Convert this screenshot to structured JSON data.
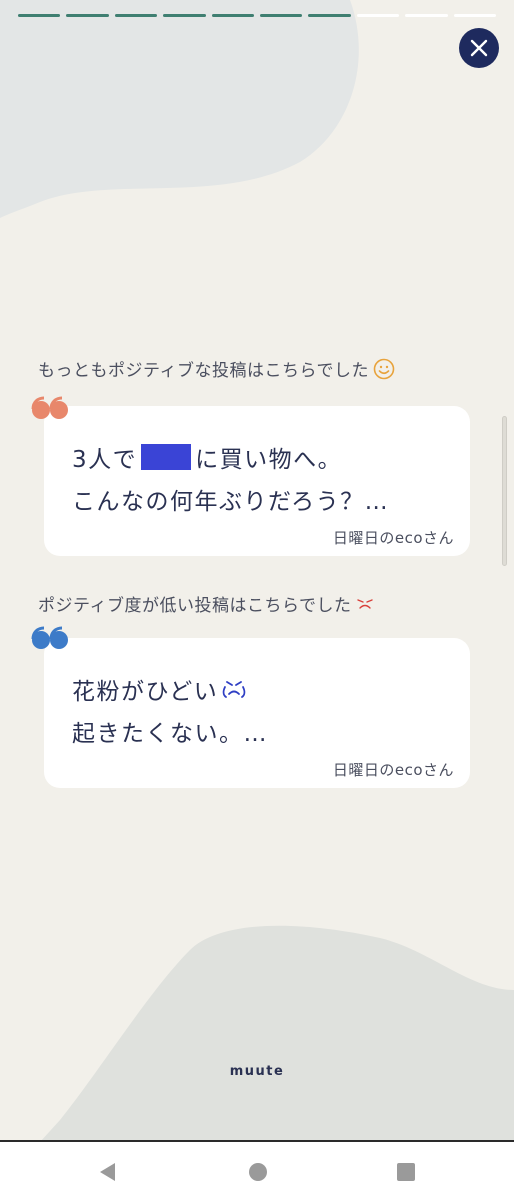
{
  "progress": {
    "total_steps": 10,
    "completed_steps": 7,
    "done_color": "#3f7f71"
  },
  "close_button": {
    "icon": "close-icon"
  },
  "positive": {
    "label": "もっともポジティブな投稿はこちらでした",
    "emoji_icon": "smile-icon",
    "quote_color": "#e8876b",
    "line1_before": "3人で",
    "line1_after": "に買い物へ。",
    "line2": "こんなの何年ぶりだろう？…",
    "author": "日曜日のecoさん"
  },
  "negative": {
    "label": "ポジティブ度が低い投稿はこちらでした",
    "emoji_icon": "sad-face-icon",
    "quote_color": "#3d7bc8",
    "line1": "花粉がひどい",
    "line1_icon": "crying-face-icon",
    "line2": "起きたくない。…",
    "author": "日曜日のecoさん"
  },
  "brand": {
    "name": "muute"
  },
  "navigation": {
    "back_icon": "back-triangle-icon",
    "home_icon": "home-circle-icon",
    "recent_icon": "recent-square-icon"
  }
}
